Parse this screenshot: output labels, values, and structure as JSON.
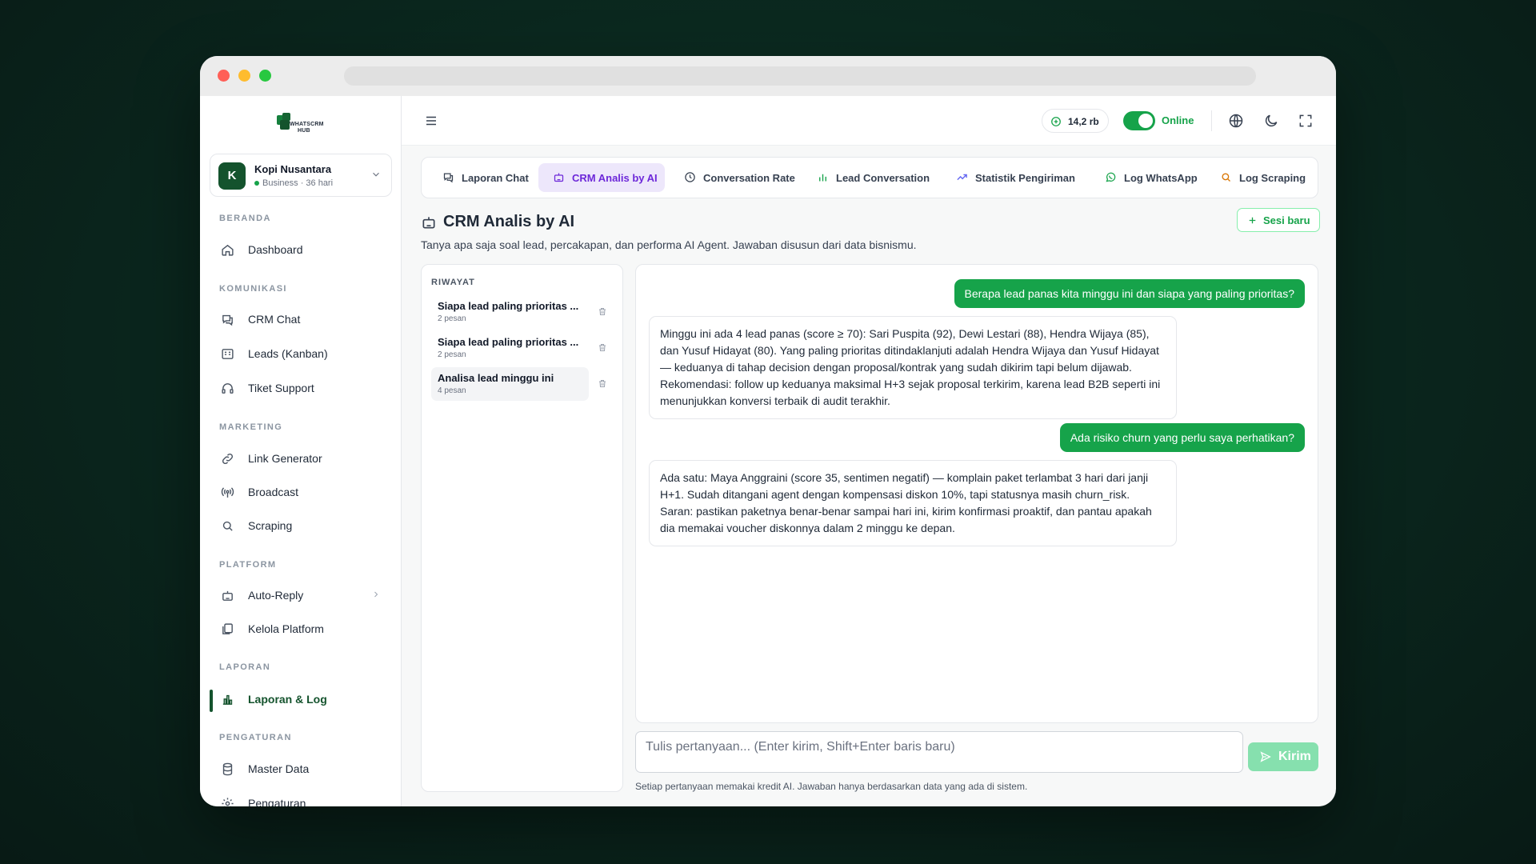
{
  "brand": {
    "name_line1": "WHATSCRM",
    "name_line2": "HUB"
  },
  "workspace": {
    "initial": "K",
    "name": "Kopi Nusantara",
    "subtitle": "Business · 36 hari"
  },
  "sidebar": {
    "sections": [
      {
        "title": "BERANDA",
        "items": [
          {
            "label": "Dashboard",
            "icon": "home-icon"
          }
        ]
      },
      {
        "title": "KOMUNIKASI",
        "items": [
          {
            "label": "CRM Chat",
            "icon": "chat-icon"
          },
          {
            "label": "Leads (Kanban)",
            "icon": "kanban-icon"
          },
          {
            "label": "Tiket Support",
            "icon": "headset-icon"
          }
        ]
      },
      {
        "title": "MARKETING",
        "items": [
          {
            "label": "Link Generator",
            "icon": "link-icon"
          },
          {
            "label": "Broadcast",
            "icon": "broadcast-icon"
          },
          {
            "label": "Scraping",
            "icon": "search-icon"
          }
        ]
      },
      {
        "title": "PLATFORM",
        "items": [
          {
            "label": "Auto-Reply",
            "icon": "bot-icon"
          },
          {
            "label": "Kelola Platform",
            "icon": "platform-icon"
          }
        ]
      },
      {
        "title": "LAPORAN",
        "items": [
          {
            "label": "Laporan & Log",
            "icon": "bar-chart-icon",
            "active": true
          }
        ]
      },
      {
        "title": "PENGATURAN",
        "items": [
          {
            "label": "Master Data",
            "icon": "database-icon"
          },
          {
            "label": "Pengaturan",
            "icon": "gear-icon"
          }
        ]
      }
    ]
  },
  "topbar": {
    "credits": "14,2 rb",
    "status": "Online",
    "accent": "#16a34a"
  },
  "tabs": [
    {
      "label": "Laporan Chat",
      "icon": "chat-icon"
    },
    {
      "label": "CRM Analis by AI",
      "icon": "bot-icon",
      "active": true
    },
    {
      "label": "Conversation Rate",
      "icon": "clock-icon"
    },
    {
      "label": "Lead Conversation",
      "icon": "bar-chart-icon"
    },
    {
      "label": "Statistik Pengiriman",
      "icon": "trend-icon"
    },
    {
      "label": "Log WhatsApp",
      "icon": "whatsapp-icon"
    },
    {
      "label": "Log Scraping",
      "icon": "search-icon"
    }
  ],
  "page": {
    "title": "CRM Analis by AI",
    "description": "Tanya apa saja soal lead, percakapan, dan performa AI Agent. Jawaban disusun dari data bisnismu.",
    "new_session": "Sesi baru"
  },
  "history": {
    "title": "RIWAYAT",
    "items": [
      {
        "title": "Siapa lead paling prioritas ...",
        "count": "2 pesan"
      },
      {
        "title": "Siapa lead paling prioritas ...",
        "count": "2 pesan"
      },
      {
        "title": "Analisa lead minggu ini",
        "count": "4 pesan",
        "active": true
      }
    ]
  },
  "messages": [
    {
      "role": "user",
      "text": "Berapa lead panas kita minggu ini dan siapa yang paling prioritas?"
    },
    {
      "role": "ai",
      "text": "Minggu ini ada 4 lead panas (score ≥ 70): Sari Puspita (92), Dewi Lestari (88), Hendra Wijaya (85), dan Yusuf Hidayat (80). Yang paling prioritas ditindaklanjuti adalah Hendra Wijaya dan Yusuf Hidayat — keduanya di tahap decision dengan proposal/kontrak yang sudah dikirim tapi belum dijawab. Rekomendasi: follow up keduanya maksimal H+3 sejak proposal terkirim, karena lead B2B seperti ini menunjukkan konversi terbaik di audit terakhir."
    },
    {
      "role": "user",
      "text": "Ada risiko churn yang perlu saya perhatikan?"
    },
    {
      "role": "ai",
      "text": "Ada satu: Maya Anggraini (score 35, sentimen negatif) — komplain paket terlambat 3 hari dari janji H+1. Sudah ditangani agent dengan kompensasi diskon 10%, tapi statusnya masih churn_risk. Saran: pastikan paketnya benar-benar sampai hari ini, kirim konfirmasi proaktif, dan pantau apakah dia memakai voucher diskonnya dalam 2 minggu ke depan."
    }
  ],
  "composer": {
    "placeholder": "Tulis pertanyaan... (Enter kirim, Shift+Enter baris baru)",
    "send_label": "Kirim",
    "footnote": "Setiap pertanyaan memakai kredit AI. Jawaban hanya berdasarkan data yang ada di sistem."
  }
}
